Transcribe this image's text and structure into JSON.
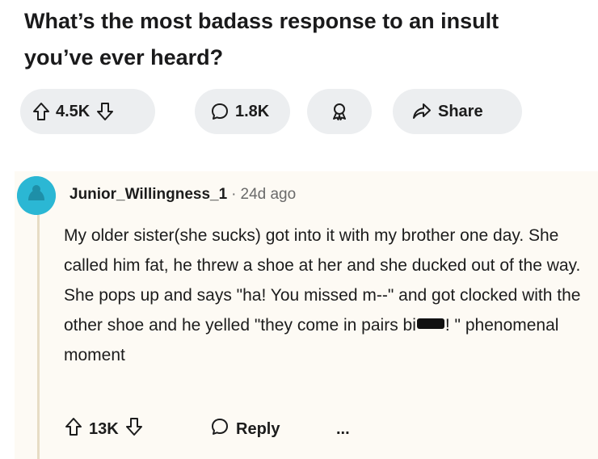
{
  "post": {
    "title": "What’s the most badass response to an insult you’ve ever heard?"
  },
  "post_actions": {
    "upvote_icon": "arrow-up-icon",
    "vote_count": "4.5K",
    "downvote_icon": "arrow-down-icon",
    "comment_icon": "speech-bubble-icon",
    "comment_count": "1.8K",
    "award_icon": "award-ribbon-icon",
    "share_icon": "share-arrow-icon",
    "share_label": "Share"
  },
  "comment": {
    "avatar_icon": "user-avatar-icon",
    "avatar_color": "#2bb7d4",
    "username": "Junior_Willingness_1",
    "separator": "·",
    "age": "24d ago",
    "text_part1": "My older sister(she sucks) got into it with my brother one day. She called him fat, he threw a shoe at her and she ducked out of the way. She pops up and says \"ha! You missed m--\" and got clocked with the other shoe and he yelled \"they come in pairs bi",
    "text_part2": "! \" phenomenal moment",
    "vote_count": "13K",
    "reply_label": "Reply",
    "more_label": "..."
  },
  "colors": {
    "pill_bg": "#eceef0",
    "comment_bg": "#fdfaf4",
    "thread_line": "#e7dcc4",
    "meta_text": "#6a6a6a"
  }
}
